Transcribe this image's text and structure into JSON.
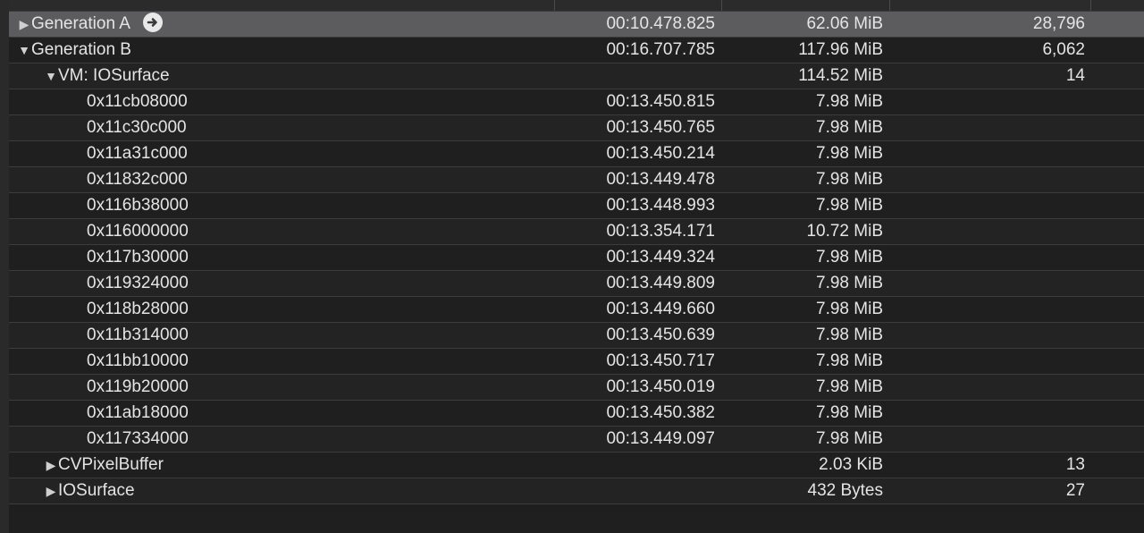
{
  "rows": [
    {
      "name": "Generation A",
      "time": "00:10.478.825",
      "size": "62.06 MiB",
      "count": "28,796"
    },
    {
      "name": "Generation B",
      "time": "00:16.707.785",
      "size": "117.96 MiB",
      "count": "6,062"
    },
    {
      "name": "VM: IOSurface",
      "time": "",
      "size": "114.52 MiB",
      "count": "14"
    },
    {
      "name": "0x11cb08000",
      "time": "00:13.450.815",
      "size": "7.98 MiB",
      "count": ""
    },
    {
      "name": "0x11c30c000",
      "time": "00:13.450.765",
      "size": "7.98 MiB",
      "count": ""
    },
    {
      "name": "0x11a31c000",
      "time": "00:13.450.214",
      "size": "7.98 MiB",
      "count": ""
    },
    {
      "name": "0x11832c000",
      "time": "00:13.449.478",
      "size": "7.98 MiB",
      "count": ""
    },
    {
      "name": "0x116b38000",
      "time": "00:13.448.993",
      "size": "7.98 MiB",
      "count": ""
    },
    {
      "name": "0x116000000",
      "time": "00:13.354.171",
      "size": "10.72 MiB",
      "count": ""
    },
    {
      "name": "0x117b30000",
      "time": "00:13.449.324",
      "size": "7.98 MiB",
      "count": ""
    },
    {
      "name": "0x119324000",
      "time": "00:13.449.809",
      "size": "7.98 MiB",
      "count": ""
    },
    {
      "name": "0x118b28000",
      "time": "00:13.449.660",
      "size": "7.98 MiB",
      "count": ""
    },
    {
      "name": "0x11b314000",
      "time": "00:13.450.639",
      "size": "7.98 MiB",
      "count": ""
    },
    {
      "name": "0x11bb10000",
      "time": "00:13.450.717",
      "size": "7.98 MiB",
      "count": ""
    },
    {
      "name": "0x119b20000",
      "time": "00:13.450.019",
      "size": "7.98 MiB",
      "count": ""
    },
    {
      "name": "0x11ab18000",
      "time": "00:13.450.382",
      "size": "7.98 MiB",
      "count": ""
    },
    {
      "name": "0x117334000",
      "time": "00:13.449.097",
      "size": "7.98 MiB",
      "count": ""
    },
    {
      "name": "CVPixelBuffer",
      "time": "",
      "size": "2.03 KiB",
      "count": "13"
    },
    {
      "name": "IOSurface",
      "time": "",
      "size": "432 Bytes",
      "count": "27"
    }
  ],
  "icons": {
    "collapsed": "disclosure-triangle-right",
    "expanded": "disclosure-triangle-down",
    "goto": "go-to-arrow-circle"
  }
}
